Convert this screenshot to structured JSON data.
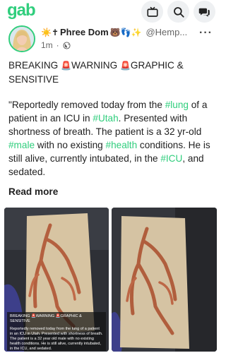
{
  "app": {
    "logo": "gab"
  },
  "topbar": {
    "icons": [
      "tv-icon",
      "search-icon",
      "chat-icon"
    ]
  },
  "post": {
    "author": {
      "name": "Phree Dom",
      "handle": "@Hemp...",
      "prefix_emojis": "☀️✝",
      "suffix_emojis": "🐻👣✨"
    },
    "time": "1m",
    "visibility_icon": "globe-icon",
    "text": {
      "p1_a": "BREAKING ",
      "p1_b": "WARNING ",
      "p1_c": "GRAPHIC & SENSITIVE",
      "alert_emoji": "🚨",
      "p2_1": "\"Reportedly removed today from the ",
      "tag_lung": "#lung",
      "p2_2": " of a patient in an ICU in ",
      "tag_utah": "#Utah",
      "p2_3": ". Presented with shortness of breath. The patient is a 32 yr-old ",
      "tag_male": "#male",
      "p2_4": " with no existing ",
      "tag_health": "#health",
      "p2_5": " conditions. He is still alive, currently intubated, in the ",
      "tag_icu": "#ICU",
      "p2_6": ", and sedated.",
      "faded": "...  ...  ...  ...  ..."
    },
    "read_more": "Read more",
    "media": {
      "caption_title": "BREAKING 🚨WARNING 🚨GRAPHIC & SENSITIVE",
      "caption_body": "Reportedly removed today from the lung of a patient in an ICU in Utah. Presented with shortness of breath. The patient is a 32 year old male with no existing health conditions. He is still alive, currently intubated, in the ICU, and sedated."
    }
  },
  "colors": {
    "brand": "#30ce7d",
    "text": "#1f1f1f",
    "muted": "#666666"
  }
}
